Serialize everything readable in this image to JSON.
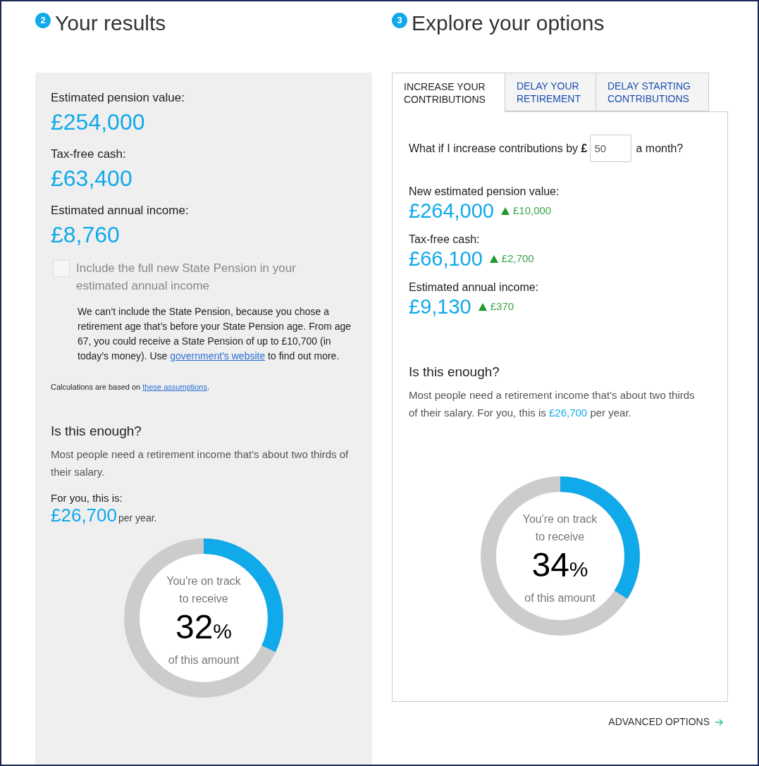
{
  "results": {
    "step": "2",
    "title": "Your results",
    "figures": [
      {
        "label": "Estimated pension value:",
        "value": "£254,000"
      },
      {
        "label": "Tax-free cash:",
        "value": "£63,400"
      },
      {
        "label": "Estimated annual income:",
        "value": "£8,760"
      }
    ],
    "state_pension": {
      "label": "Include the full new State Pension in your estimated annual income",
      "checked": false,
      "disabled": true
    },
    "note": {
      "before": "We can’t include the State Pension, because you chose a retirement age that’s before your State Pension age. From age 67, you could receive a State Pension of up to £10,700 (in today’s money). Use",
      "link": "government's website",
      "after": "to find out more."
    },
    "assumptions": {
      "before": "Calculations are based on",
      "link": "these assumptions",
      "after": "."
    },
    "enough": {
      "title": "Is this enough?",
      "text": "Most people need a retirement income that's about two thirds of their salary.",
      "for_you": "For you, this is:",
      "amount": "£26,700",
      "per": "per year."
    },
    "gauge": {
      "top": "You're on track",
      "middle": "to receive",
      "percent": "32",
      "sign": "%",
      "bottom": "of this amount",
      "level": 0.32
    }
  },
  "options": {
    "step": "3",
    "title": "Explore your options",
    "tabs": [
      {
        "label": "INCREASE YOUR CONTRIBUTIONS",
        "selected": true
      },
      {
        "label": "DELAY YOUR RETIREMENT",
        "selected": false
      },
      {
        "label": "DELAY STARTING CONTRIBUTIONS",
        "selected": false
      }
    ],
    "question": {
      "before": "What if I increase contributions by **£**",
      "value": "50",
      "after": "a month?"
    },
    "figures": [
      {
        "label": "New estimated pension value:",
        "value": "£264,000",
        "change": "£10,000"
      },
      {
        "label": "Tax-free cash:",
        "value": "£66,100",
        "change": "£2,700"
      },
      {
        "label": "Estimated annual income:",
        "value": "£9,130",
        "change": "£370"
      }
    ],
    "enough": {
      "title": "Is this enough?",
      "before": "Most people need a retirement income that's about two thirds of their salary. For you, this is",
      "amount": "£26,700",
      "after": "per year."
    },
    "gauge": {
      "top": "You're on track",
      "middle": "to receive",
      "percent": "34",
      "sign": "%",
      "bottom": "of this amount",
      "level": 0.34
    },
    "advanced": "ADVANCED OPTIONS"
  }
}
